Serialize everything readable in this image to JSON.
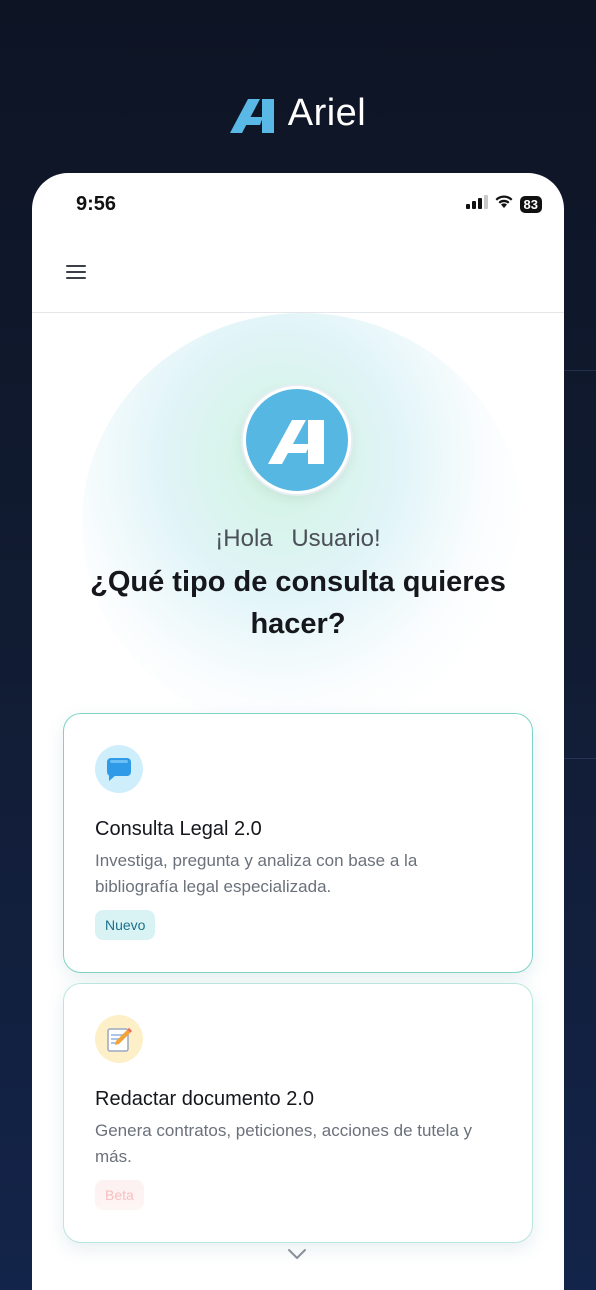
{
  "brand": {
    "name": "Ariel",
    "icon": "ariel-logo"
  },
  "status_bar": {
    "time": "9:56",
    "battery": "83",
    "icons": [
      "signal-icon",
      "wifi-icon",
      "battery-icon"
    ]
  },
  "header": {
    "menu_icon": "hamburger-menu-icon"
  },
  "hero": {
    "greeting_prefix": "¡Hola",
    "greeting_name": "Usuario!",
    "question": "¿Qué tipo de consulta quieres hacer?"
  },
  "cards": [
    {
      "icon": "chat-bubble-icon",
      "title": "Consulta Legal 2.0",
      "description": "Investiga, pregunta y analiza con base a la bibliografía legal especializada.",
      "badge": "Nuevo"
    },
    {
      "icon": "memo-pencil-icon",
      "title": "Redactar documento 2.0",
      "description": "Genera contratos, peticiones, acciones de tutela y más.",
      "badge": "Beta"
    }
  ],
  "scroll_hint": {
    "icon": "chevron-down-icon"
  },
  "colors": {
    "accent": "#57b7e3",
    "card_border": "#7fd3c5",
    "badge_new_bg": "#d9f3f5",
    "badge_beta_text": "#f3a4a4"
  }
}
